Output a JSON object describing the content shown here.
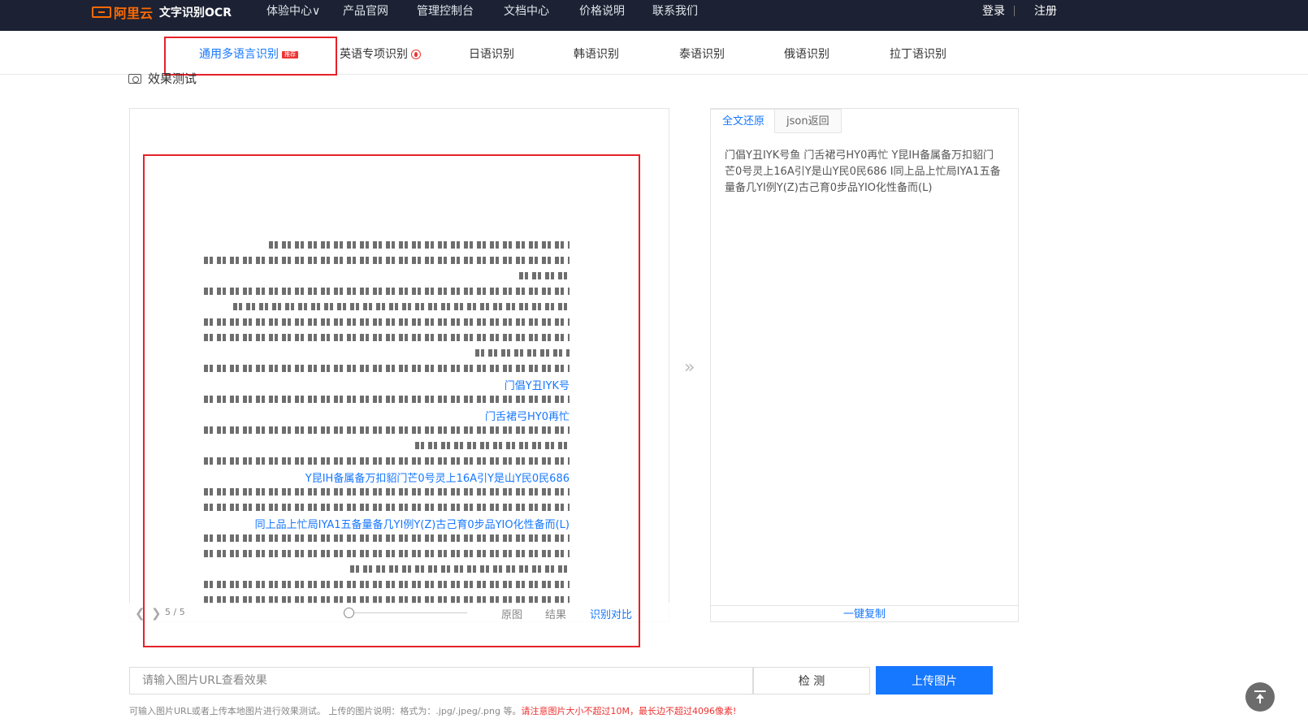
{
  "header": {
    "brand": "阿里云",
    "product": "文字识别OCR",
    "nav": [
      "体验中心∨",
      "产品官网",
      "管理控制台",
      "文档中心",
      "价格说明",
      "联系我们"
    ],
    "login": "登录",
    "register": "注册"
  },
  "tabs": [
    {
      "label": "通用多语言识别",
      "badge": "推荐",
      "active": true
    },
    {
      "label": "英语专项识别",
      "icon": "hot-icon"
    },
    {
      "label": "日语识别"
    },
    {
      "label": "韩语识别"
    },
    {
      "label": "泰语识别"
    },
    {
      "label": "俄语识别"
    },
    {
      "label": "拉丁语识别"
    }
  ],
  "section": {
    "title": "效果测试"
  },
  "viewer": {
    "page": "5 / 5",
    "original": "原图",
    "result": "结果",
    "compare": "识别对比",
    "highlights": [
      "门倡Y丑IYK号",
      "门舌裙弓HY0再忙",
      "Y昆IH备属备万扣貂门芒0号灵上16A引Y是山Y民0民686",
      "同上品上忙局IYA1五备量备几YI例Y(Z)古己育0步品YIO化性备而(L)"
    ]
  },
  "result": {
    "tabs": [
      "全文还原",
      "json返回"
    ],
    "text": "门倡Y丑IYK号鱼 门舌裙弓HY0再忙 Y昆IH备属备万扣貂门芒0号灵上16A引Y是山Y民0民686 I同上品上忙局IYA1五备量备几YI例Y(Z)古己育0步品YIO化性备而(L)",
    "copy": "一键复制"
  },
  "input": {
    "placeholder": "请输入图片URL查看效果",
    "detect": "检 测",
    "upload": "上传图片"
  },
  "hint": {
    "normal": "可输入图片URL或者上传本地图片进行效果测试。 上传的图片说明：格式为：.jpg/.jpeg/.png 等。",
    "warn": "请注意图片大小不超过10M，最长边不超过4096像素!"
  },
  "colors": {
    "accent": "#1677ff",
    "header_bg": "#1c2233",
    "brand": "#ff6a00",
    "annotation": "#e5222a"
  }
}
